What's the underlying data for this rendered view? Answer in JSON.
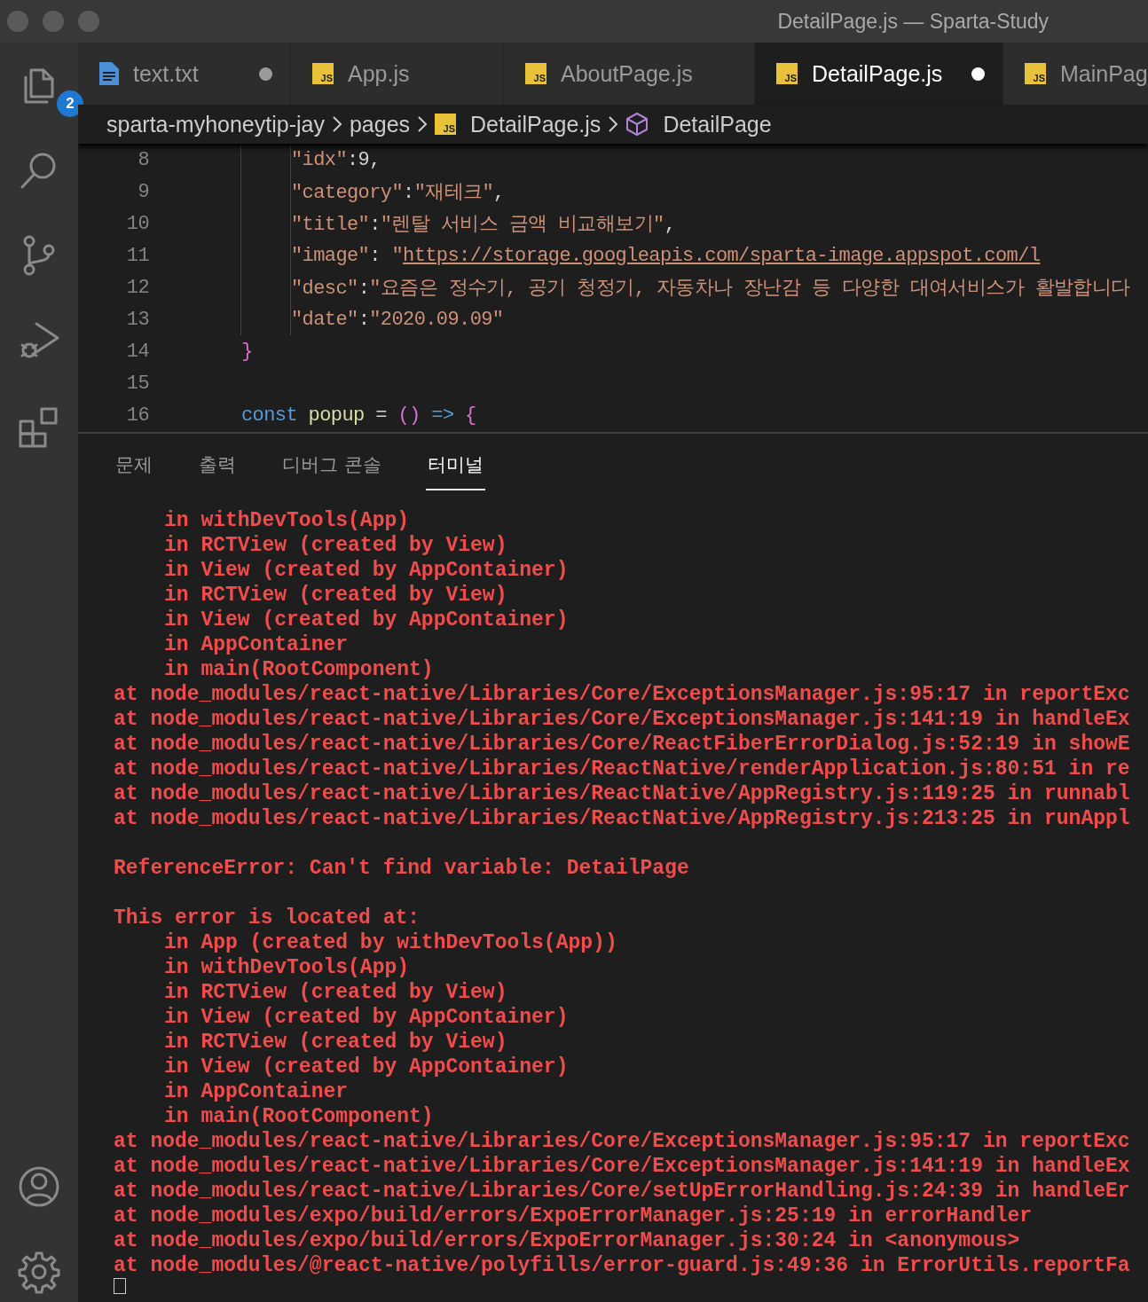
{
  "window": {
    "title": "DetailPage.js — Sparta-Study"
  },
  "activity_bar": {
    "explorer_badge": "2"
  },
  "tabs": [
    {
      "label": "text.txt",
      "kind": "text",
      "dirty": true,
      "selected": false
    },
    {
      "label": "App.js",
      "kind": "js",
      "icon_text": "JS",
      "dirty": false,
      "selected": false
    },
    {
      "label": "AboutPage.js",
      "kind": "js",
      "icon_text": "JS",
      "dirty": false,
      "selected": false
    },
    {
      "label": "DetailPage.js",
      "kind": "js",
      "icon_text": "JS",
      "dirty": true,
      "selected": true
    },
    {
      "label": "MainPag",
      "kind": "js",
      "icon_text": "JS",
      "dirty": false,
      "selected": false
    }
  ],
  "breadcrumb": [
    {
      "label": "sparta-myhoneytip-jay",
      "kind": "folder"
    },
    {
      "label": "pages",
      "kind": "folder"
    },
    {
      "label": "DetailPage.js",
      "kind": "js",
      "icon_text": "JS"
    },
    {
      "label": "DetailPage",
      "kind": "component"
    }
  ],
  "editor": {
    "lines": [
      {
        "number": "8",
        "kind": "prop",
        "tokens": [
          {
            "text": "\"idx\"",
            "kind": "str"
          },
          {
            "text": ":9,",
            "kind": "punct"
          }
        ]
      },
      {
        "number": "9",
        "kind": "prop",
        "tokens": [
          {
            "text": "\"category\"",
            "kind": "str"
          },
          {
            "text": ":",
            "kind": "punct"
          },
          {
            "text": "\"재테크\"",
            "kind": "str"
          },
          {
            "text": ",",
            "kind": "punct"
          }
        ]
      },
      {
        "number": "10",
        "kind": "prop",
        "tokens": [
          {
            "text": "\"title\"",
            "kind": "str"
          },
          {
            "text": ":",
            "kind": "punct"
          },
          {
            "text": "\"렌탈 서비스 금액 비교해보기\"",
            "kind": "str"
          },
          {
            "text": ",",
            "kind": "punct"
          }
        ]
      },
      {
        "number": "11",
        "kind": "prop",
        "tokens": [
          {
            "text": "\"image\"",
            "kind": "str"
          },
          {
            "text": ": ",
            "kind": "punct"
          },
          {
            "text": "\"",
            "kind": "str"
          },
          {
            "text": "https://storage.googleapis.com/sparta-image.appspot.com/l",
            "kind": "link"
          }
        ]
      },
      {
        "number": "12",
        "kind": "prop",
        "tokens": [
          {
            "text": "\"desc\"",
            "kind": "str"
          },
          {
            "text": ":",
            "kind": "punct"
          },
          {
            "text": "\"요즘은 정수기, 공기 청정기, 자동차나 장난감 등 다양한 대여서비스가 활발합니다",
            "kind": "str"
          }
        ]
      },
      {
        "number": "13",
        "kind": "prop",
        "tokens": [
          {
            "text": "\"date\"",
            "kind": "str"
          },
          {
            "text": ":",
            "kind": "punct"
          },
          {
            "text": "\"2020.09.09\"",
            "kind": "str"
          }
        ]
      },
      {
        "number": "14",
        "kind": "top",
        "tokens": [
          {
            "text": "}",
            "kind": "brace"
          }
        ]
      },
      {
        "number": "15",
        "kind": "top"
      },
      {
        "number": "16",
        "kind": "top",
        "tokens": [
          {
            "text": "const",
            "kind": "kw"
          },
          {
            "text": " popup",
            "kind": "fn"
          },
          {
            "text": " = ",
            "kind": "punct"
          },
          {
            "text": "()",
            "kind": "brace"
          },
          {
            "text": " => ",
            "kind": "kw"
          },
          {
            "text": "{",
            "kind": "brace"
          }
        ]
      }
    ]
  },
  "panel": {
    "tabs": [
      {
        "label": "문제",
        "selected": false
      },
      {
        "label": "출력",
        "selected": false
      },
      {
        "label": "디버그 콘솔",
        "selected": false
      },
      {
        "label": "터미널",
        "selected": true
      }
    ]
  },
  "terminal": {
    "lines": [
      {
        "kind": "frame",
        "text": "in withDevTools(App)"
      },
      {
        "kind": "frame",
        "text": "in RCTView (created by View)"
      },
      {
        "kind": "frame",
        "text": "in View (created by AppContainer)"
      },
      {
        "kind": "frame",
        "text": "in RCTView (created by View)"
      },
      {
        "kind": "frame",
        "text": "in View (created by AppContainer)"
      },
      {
        "kind": "frame",
        "text": "in AppContainer"
      },
      {
        "kind": "frame",
        "text": "in main(RootComponent)"
      },
      {
        "kind": "trace",
        "text": "at node_modules/react-native/Libraries/Core/ExceptionsManager.js:95:17 in reportExc"
      },
      {
        "kind": "trace",
        "text": "at node_modules/react-native/Libraries/Core/ExceptionsManager.js:141:19 in handleEx"
      },
      {
        "kind": "trace",
        "text": "at node_modules/react-native/Libraries/Core/ReactFiberErrorDialog.js:52:19 in showE"
      },
      {
        "kind": "trace",
        "text": "at node_modules/react-native/Libraries/ReactNative/renderApplication.js:80:51 in re"
      },
      {
        "kind": "trace",
        "text": "at node_modules/react-native/Libraries/ReactNative/AppRegistry.js:119:25 in runnabl"
      },
      {
        "kind": "trace",
        "text": "at node_modules/react-native/Libraries/ReactNative/AppRegistry.js:213:25 in runAppl"
      },
      {
        "kind": "blank"
      },
      {
        "kind": "trace",
        "text": "ReferenceError: Can't find variable: DetailPage"
      },
      {
        "kind": "blank"
      },
      {
        "kind": "trace",
        "text": "This error is located at:"
      },
      {
        "kind": "frame",
        "text": "in App (created by withDevTools(App))"
      },
      {
        "kind": "frame",
        "text": "in withDevTools(App)"
      },
      {
        "kind": "frame",
        "text": "in RCTView (created by View)"
      },
      {
        "kind": "frame",
        "text": "in View (created by AppContainer)"
      },
      {
        "kind": "frame",
        "text": "in RCTView (created by View)"
      },
      {
        "kind": "frame",
        "text": "in View (created by AppContainer)"
      },
      {
        "kind": "frame",
        "text": "in AppContainer"
      },
      {
        "kind": "frame",
        "text": "in main(RootComponent)"
      },
      {
        "kind": "trace",
        "text": "at node_modules/react-native/Libraries/Core/ExceptionsManager.js:95:17 in reportExc"
      },
      {
        "kind": "trace",
        "text": "at node_modules/react-native/Libraries/Core/ExceptionsManager.js:141:19 in handleEx"
      },
      {
        "kind": "trace",
        "text": "at node_modules/react-native/Libraries/Core/setUpErrorHandling.js:24:39 in handleEr"
      },
      {
        "kind": "trace",
        "text": "at node_modules/expo/build/errors/ExpoErrorManager.js:25:19 in errorHandler"
      },
      {
        "kind": "trace",
        "text": "at node_modules/expo/build/errors/ExpoErrorManager.js:30:24 in <anonymous>"
      },
      {
        "kind": "trace",
        "text": "at node_modules/@react-native/polyfills/error-guard.js:49:36 in ErrorUtils.reportFa"
      }
    ]
  }
}
